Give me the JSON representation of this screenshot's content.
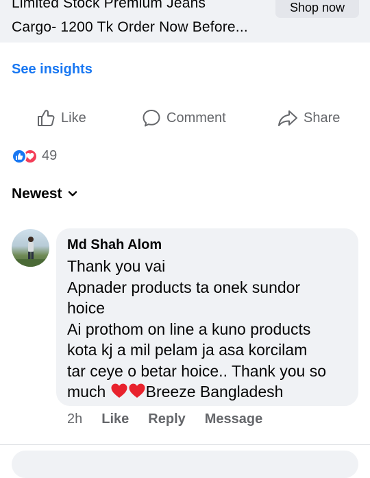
{
  "ad": {
    "title_line1": "Limited Stock Premium Jeans",
    "title_line2": "Cargo- 1200 Tk Order Now Before...",
    "cta_label": "Shop now"
  },
  "insights_label": "See insights",
  "actions": {
    "like": "Like",
    "comment": "Comment",
    "share": "Share"
  },
  "reactions": {
    "count": "49",
    "types": [
      "like-icon",
      "love-icon"
    ],
    "colors": {
      "like": "#1877f2",
      "love": "#f33e58"
    }
  },
  "sort": {
    "label": "Newest"
  },
  "comment": {
    "author": "Md Shah Alom",
    "lines": [
      "Thank you vai",
      "Apnader products ta onek sundor",
      "hoice",
      "Ai prothom on line a kuno products",
      "kota kj a mil pelam ja asa korcilam",
      "tar ceye o betar hoice.. Thank you so",
      "much"
    ],
    "last_line_suffix": "Breeze Bangladesh",
    "time": "2h",
    "like_label": "Like",
    "reply_label": "Reply",
    "message_label": "Message"
  },
  "colors": {
    "accent": "#1877f2",
    "secondary_text": "#65676b",
    "bubble": "#f0f2f5",
    "heart": "#e8222d"
  }
}
